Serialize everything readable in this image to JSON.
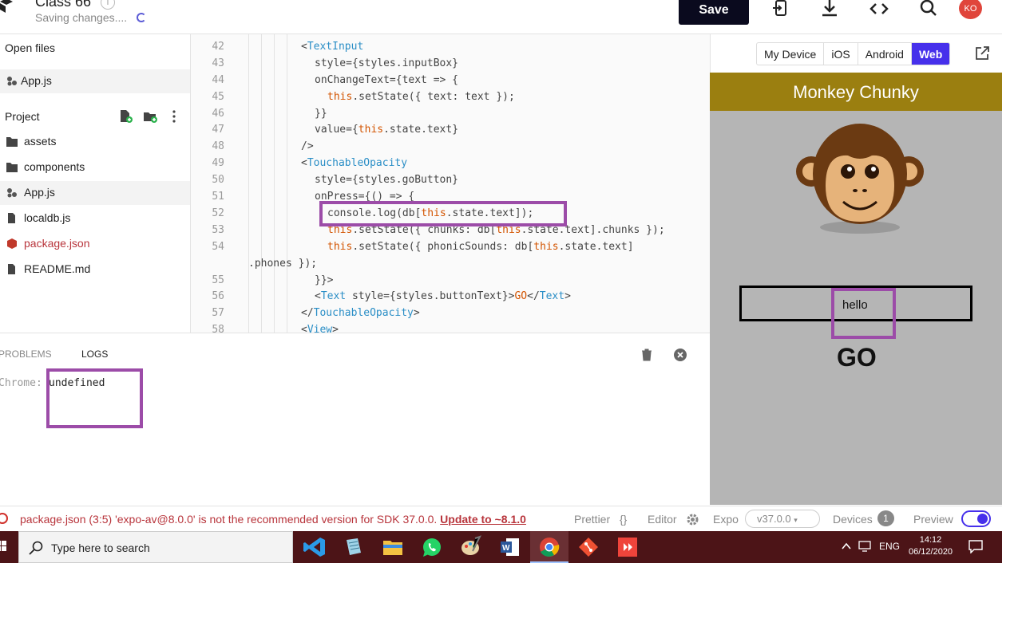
{
  "header": {
    "title": "Class 66",
    "subtitle": "Saving changes....",
    "save_label": "Save",
    "avatar_initials": "KO",
    "icons": [
      "export-device-icon",
      "download-icon",
      "embed-code-icon",
      "search-icon"
    ]
  },
  "sidebar": {
    "open_files_label": "Open files",
    "open_file": "App.js",
    "project_label": "Project",
    "items": [
      {
        "label": "assets",
        "icon": "folder-icon"
      },
      {
        "label": "components",
        "icon": "folder-icon"
      },
      {
        "label": "App.js",
        "icon": "js-file-icon"
      },
      {
        "label": "localdb.js",
        "icon": "file-icon"
      },
      {
        "label": "package.json",
        "icon": "package-icon"
      },
      {
        "label": "README.md",
        "icon": "file-icon"
      }
    ]
  },
  "editor": {
    "lines": [
      {
        "n": "42",
        "text": "<TextInput"
      },
      {
        "n": "43",
        "text": "style={styles.inputBox}"
      },
      {
        "n": "44",
        "text": "onChangeText={text => {"
      },
      {
        "n": "45",
        "text": "this.setState({ text: text });"
      },
      {
        "n": "46",
        "text": "}}"
      },
      {
        "n": "47",
        "text": "value={this.state.text}"
      },
      {
        "n": "48",
        "text": "/>"
      },
      {
        "n": "49",
        "text": "<TouchableOpacity"
      },
      {
        "n": "50",
        "text": "style={styles.goButton}"
      },
      {
        "n": "51",
        "text": "onPress={() => {"
      },
      {
        "n": "52",
        "text": "console.log(db[this.state.text]);"
      },
      {
        "n": "53",
        "text": "this.setState({ chunks: db[this.state.text].chunks });"
      },
      {
        "n": "54",
        "text": "this.setState({ phonicSounds: db[this.state.text]"
      },
      {
        "n": "",
        "text": ".phones });"
      },
      {
        "n": "55",
        "text": "}}>"
      },
      {
        "n": "56",
        "text": "<Text style={styles.buttonText}>GO</Text>"
      },
      {
        "n": "57",
        "text": "</TouchableOpacity>"
      },
      {
        "n": "58",
        "text": "<View>"
      }
    ]
  },
  "logs": {
    "tabs": [
      "PROBLEMS",
      "LOGS"
    ],
    "source": "Chrome:",
    "message": "undefined"
  },
  "preview": {
    "platforms": [
      "My Device",
      "iOS",
      "Android",
      "Web"
    ],
    "selected_platform": "Web",
    "app_title": "Monkey Chunky",
    "input_value": "hello",
    "go_label": "GO"
  },
  "statusbar": {
    "error_text": "package.json (3:5) 'expo-av@8.0.0' is not the recommended version for SDK 37.0.0.",
    "error_link": "Update to ~8.1.0",
    "prettier": "Prettier",
    "prettier_glyph": "{}",
    "editor": "Editor",
    "expo": "Expo",
    "expo_version": "v37.0.0",
    "expo_version_caret": "▾",
    "devices": "Devices",
    "devices_count": "1",
    "preview": "Preview"
  },
  "taskbar": {
    "search_placeholder": "Type here to search",
    "language": "ENG",
    "time": "14:12",
    "date": "06/12/2020",
    "apps": [
      "vscode",
      "notepad",
      "file-explorer",
      "whatsapp",
      "paint",
      "word",
      "chrome",
      "git",
      "anydesk"
    ]
  },
  "colors": {
    "accent": "#4630eb",
    "app_header": "#9b7f10",
    "highlight": "#9c4ca8",
    "error": "#b8343b",
    "taskbar": "#4c1417"
  }
}
